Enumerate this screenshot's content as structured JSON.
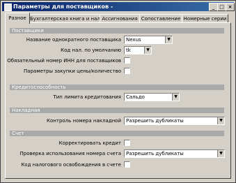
{
  "window": {
    "title": "Параметры для поставщиков -",
    "controls": {
      "minimize": "_",
      "maximize": "□",
      "close": "×"
    }
  },
  "tabs": [
    {
      "label": "Разное"
    },
    {
      "label": "Бухгалтерская книга и налог"
    },
    {
      "label": "Ассигнования"
    },
    {
      "label": "Сопоставление"
    },
    {
      "label": "Номерные серии"
    }
  ],
  "sections": {
    "vendors": {
      "title": "Поставщики"
    },
    "creditworthiness": {
      "title": "Кредитоспособность"
    },
    "invoice": {
      "title": "Накладная"
    },
    "account": {
      "title": "Счет"
    }
  },
  "fields": {
    "one_time_vendor_name": {
      "label": "Название однократного поставщика",
      "value": "Nexus"
    },
    "default_vendor_code": {
      "label": "Код нал. по умолчанию",
      "value": "tk"
    },
    "required_vendor_tax_id": {
      "label": "Обязательный номер ИНН для поставщиков"
    },
    "purchase_price_params": {
      "label": "Параметры закупки цены/количество"
    },
    "credit_limit_type": {
      "label": "Тип лимита кредитования",
      "value": "Сальдо"
    },
    "invoice_number_control": {
      "label": "Контроль номера накладной",
      "value": "Разрешить дубликаты"
    },
    "adjust_credit_limit": {
      "label": "Корректировать кредит"
    },
    "duplicate_check_control": {
      "label": "Проверка использования номера счета",
      "value": "Разрешить дубликаты"
    },
    "account_number_usage": {
      "label": "Код налогового освобождения в счете"
    }
  }
}
